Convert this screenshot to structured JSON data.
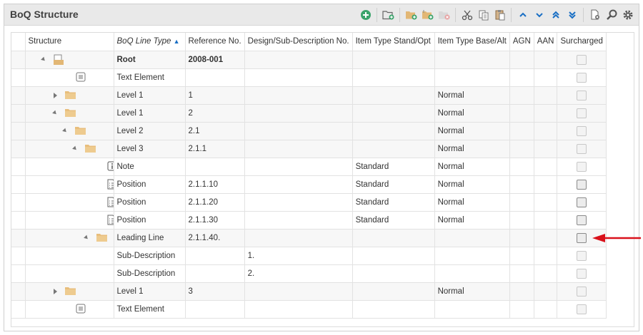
{
  "panel": {
    "title": "BoQ Structure"
  },
  "toolbar": {
    "buttons": [
      "add-icon",
      "new-folder-icon",
      "add-level-icon",
      "add-sublevel-icon",
      "delete-icon",
      "cut-icon",
      "copy-icon",
      "paste-icon",
      "move-up-icon",
      "move-down-icon",
      "move-top-icon",
      "move-bottom-icon",
      "settings-doc-icon",
      "search-icon",
      "gear-icon"
    ]
  },
  "grid": {
    "columns": [
      "Structure",
      "BoQ Line Type",
      "Reference No.",
      "Design/Sub-Description No.",
      "Item Type Stand/Opt",
      "Item Type Base/Alt",
      "AGN",
      "AAN",
      "Surcharged"
    ],
    "sorted_column": "BoQ Line Type",
    "rows": [
      {
        "line_type": "Root",
        "ref": "2008-001",
        "design": "",
        "stand_opt": "",
        "base_alt": "",
        "agn": "",
        "aan": "",
        "surcharged": false
      },
      {
        "line_type": "Text Element",
        "ref": "",
        "design": "",
        "stand_opt": "",
        "base_alt": "",
        "agn": "",
        "aan": "",
        "surcharged": false
      },
      {
        "line_type": "Level 1",
        "ref": "1",
        "design": "",
        "stand_opt": "",
        "base_alt": "Normal",
        "agn": "",
        "aan": "",
        "surcharged": false
      },
      {
        "line_type": "Level 1",
        "ref": "2",
        "design": "",
        "stand_opt": "",
        "base_alt": "Normal",
        "agn": "",
        "aan": "",
        "surcharged": false
      },
      {
        "line_type": "Level 2",
        "ref": "2.1",
        "design": "",
        "stand_opt": "",
        "base_alt": "Normal",
        "agn": "",
        "aan": "",
        "surcharged": false
      },
      {
        "line_type": "Level 3",
        "ref": "2.1.1",
        "design": "",
        "stand_opt": "",
        "base_alt": "Normal",
        "agn": "",
        "aan": "",
        "surcharged": false
      },
      {
        "line_type": "Note",
        "ref": "",
        "design": "",
        "stand_opt": "Standard",
        "base_alt": "Normal",
        "agn": "",
        "aan": "",
        "surcharged": false
      },
      {
        "line_type": "Position",
        "ref": "2.1.1.10",
        "design": "",
        "stand_opt": "Standard",
        "base_alt": "Normal",
        "agn": "",
        "aan": "",
        "surcharged": false
      },
      {
        "line_type": "Position",
        "ref": "2.1.1.20",
        "design": "",
        "stand_opt": "Standard",
        "base_alt": "Normal",
        "agn": "",
        "aan": "",
        "surcharged": false
      },
      {
        "line_type": "Position",
        "ref": "2.1.1.30",
        "design": "",
        "stand_opt": "Standard",
        "base_alt": "Normal",
        "agn": "",
        "aan": "",
        "surcharged": false
      },
      {
        "line_type": "Leading Line",
        "ref": "2.1.1.40.",
        "design": "",
        "stand_opt": "",
        "base_alt": "",
        "agn": "",
        "aan": "",
        "surcharged": false
      },
      {
        "line_type": "Sub-Description",
        "ref": "",
        "design": "1.",
        "stand_opt": "",
        "base_alt": "",
        "agn": "",
        "aan": "",
        "surcharged": false
      },
      {
        "line_type": "Sub-Description",
        "ref": "",
        "design": "2.",
        "stand_opt": "",
        "base_alt": "",
        "agn": "",
        "aan": "",
        "surcharged": false
      },
      {
        "line_type": "Level 1",
        "ref": "3",
        "design": "",
        "stand_opt": "",
        "base_alt": "Normal",
        "agn": "",
        "aan": "",
        "surcharged": false
      },
      {
        "line_type": "Text Element",
        "ref": "",
        "design": "",
        "stand_opt": "",
        "base_alt": "",
        "agn": "",
        "aan": "",
        "surcharged": false
      }
    ]
  },
  "colors": {
    "accent": "#1a6fc4",
    "add_green": "#3aa36b",
    "folder": "#e2b775",
    "annotation_arrow": "#d9111b"
  }
}
